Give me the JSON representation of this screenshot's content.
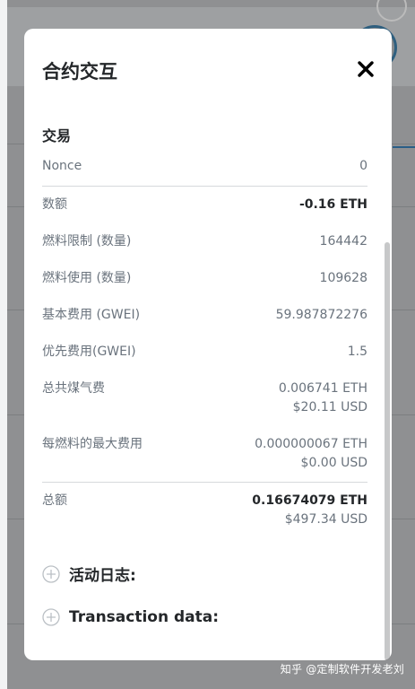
{
  "modal": {
    "title": "合约交互",
    "close_icon": "close-icon"
  },
  "transaction": {
    "section_title": "交易",
    "nonce": {
      "label": "Nonce",
      "value": "0"
    },
    "amount": {
      "label": "数额",
      "value": "-0.16 ETH"
    },
    "gas_limit": {
      "label": "燃料限制 (数量)",
      "value": "164442"
    },
    "gas_used": {
      "label": "燃料使用 (数量)",
      "value": "109628"
    },
    "base_fee": {
      "label": "基本费用 (GWEI)",
      "value": "59.987872276"
    },
    "priority_fee": {
      "label": "优先费用(GWEI)",
      "value": "1.5"
    },
    "total_gas_fee": {
      "label": "总共煤气费",
      "value_eth": "0.006741 ETH",
      "value_usd": "$20.11 USD"
    },
    "max_fee_per_gas": {
      "label": "每燃料的最大费用",
      "value_eth": "0.000000067 ETH",
      "value_usd": "$0.00 USD"
    },
    "total": {
      "label": "总额",
      "value_eth": "0.16674079 ETH",
      "value_usd": "$497.34 USD"
    }
  },
  "expanders": {
    "activity_log": {
      "label": "活动日志:",
      "icon": "plus-circle-icon"
    },
    "transaction_data": {
      "label": "Transaction data:",
      "icon": "plus-circle-icon"
    }
  },
  "watermark": "知乎 @定制软件开发老刘",
  "colors": {
    "label": "#6a737d",
    "value_strong": "#24272a",
    "divider": "#d6d9dc"
  }
}
